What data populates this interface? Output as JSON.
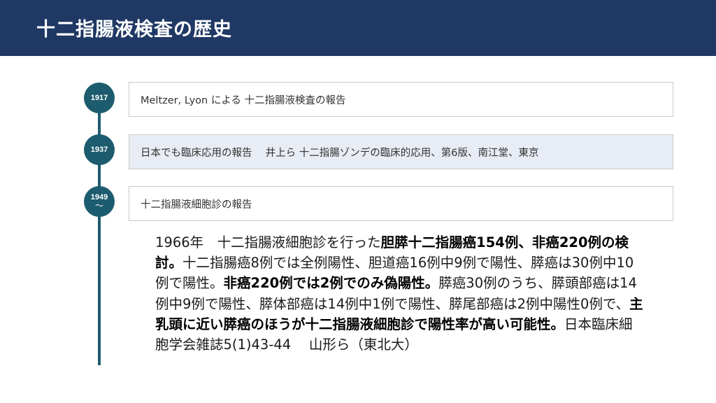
{
  "header": {
    "title": "十二指腸液検査の歴史"
  },
  "timeline": {
    "events": [
      {
        "year": "1917",
        "text": "Meltzer, Lyon による 十二指腸液検査の報告"
      },
      {
        "year": "1937",
        "text": "日本でも臨床応用の報告　 井上ら 十二指腸ゾンデの臨床的応用、第6版、南江堂、東京"
      },
      {
        "year": "1949",
        "suffix": "～",
        "text": "十二指腸液細胞診の報告"
      }
    ]
  },
  "detail": {
    "segments": [
      {
        "text": "1966年　十二指腸液細胞診を行った",
        "bold": false
      },
      {
        "text": "胆膵十二指腸癌154例、非癌220例の検討。",
        "bold": true
      },
      {
        "text": "十二指腸癌8例では全例陽性、胆道癌16例中9例で陽性、膵癌は30例中10例で陽性。",
        "bold": false
      },
      {
        "text": "非癌220例では2例でのみ偽陽性。",
        "bold": true
      },
      {
        "text": "膵癌30例のうち、膵頭部癌は14例中9例で陽性、膵体部癌は14例中1例で陽性、膵尾部癌は2例中陽性0例で、",
        "bold": false
      },
      {
        "text": "主乳頭に近い膵癌のほうが十二指腸液細胞診で陽性率が高い可能性。",
        "bold": true
      },
      {
        "text": "日本臨床細胞学会雑誌5(1)43-44　 山形ら（東北大）",
        "bold": false
      }
    ]
  }
}
